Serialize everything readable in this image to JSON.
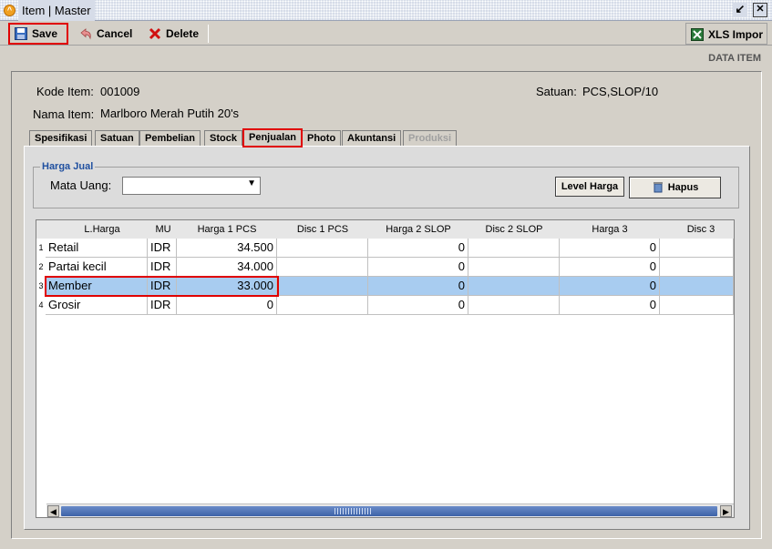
{
  "window": {
    "title": "Item | Master"
  },
  "toolbar": {
    "save": "Save",
    "cancel": "Cancel",
    "delete": "Delete",
    "xls_import": "XLS Impor"
  },
  "header": {
    "section_label": "DATA ITEM"
  },
  "item": {
    "kode_label": "Kode Item:",
    "kode_value": "001009",
    "nama_label": "Nama Item:",
    "nama_value": "Marlboro Merah Putih 20's",
    "satuan_label": "Satuan:",
    "satuan_value": "PCS,SLOP/10"
  },
  "tabs": [
    {
      "label": "Spesifikasi"
    },
    {
      "label": "Satuan"
    },
    {
      "label": "Pembelian"
    },
    {
      "label": "Stock"
    },
    {
      "label": "Penjualan",
      "active": true
    },
    {
      "label": "Photo"
    },
    {
      "label": "Akuntansi"
    },
    {
      "label": "Produksi",
      "disabled": true
    }
  ],
  "harga_jual": {
    "group_title": "Harga Jual",
    "mata_uang_label": "Mata Uang:",
    "mata_uang_value": "",
    "level_harga_button": "Level Harga",
    "hapus_button": "Hapus"
  },
  "grid": {
    "columns": [
      "L.Harga",
      "MU",
      "Harga 1 PCS",
      "Disc 1 PCS",
      "Harga 2 SLOP",
      "Disc 2 SLOP",
      "Harga 3",
      "Disc 3"
    ],
    "rows": [
      {
        "no": "1",
        "lharga": "Retail",
        "mu": "IDR",
        "harga1": "34.500",
        "disc1": "",
        "harga2": "0",
        "disc2": "",
        "harga3": "0",
        "disc3": ""
      },
      {
        "no": "2",
        "lharga": "Partai kecil",
        "mu": "IDR",
        "harga1": "34.000",
        "disc1": "",
        "harga2": "0",
        "disc2": "",
        "harga3": "0",
        "disc3": ""
      },
      {
        "no": "3",
        "lharga": "Member",
        "mu": "IDR",
        "harga1": "33.000",
        "disc1": "",
        "harga2": "0",
        "disc2": "",
        "harga3": "0",
        "disc3": "",
        "selected": true
      },
      {
        "no": "4",
        "lharga": "Grosir",
        "mu": "IDR",
        "harga1": "0",
        "disc1": "",
        "harga2": "0",
        "disc2": "",
        "harga3": "0",
        "disc3": ""
      }
    ]
  },
  "colors": {
    "highlight_red": "#e00000",
    "selected_row": "#a8ccf0",
    "group_title": "#2050a0",
    "scroll_thumb": "#3d62a8"
  }
}
